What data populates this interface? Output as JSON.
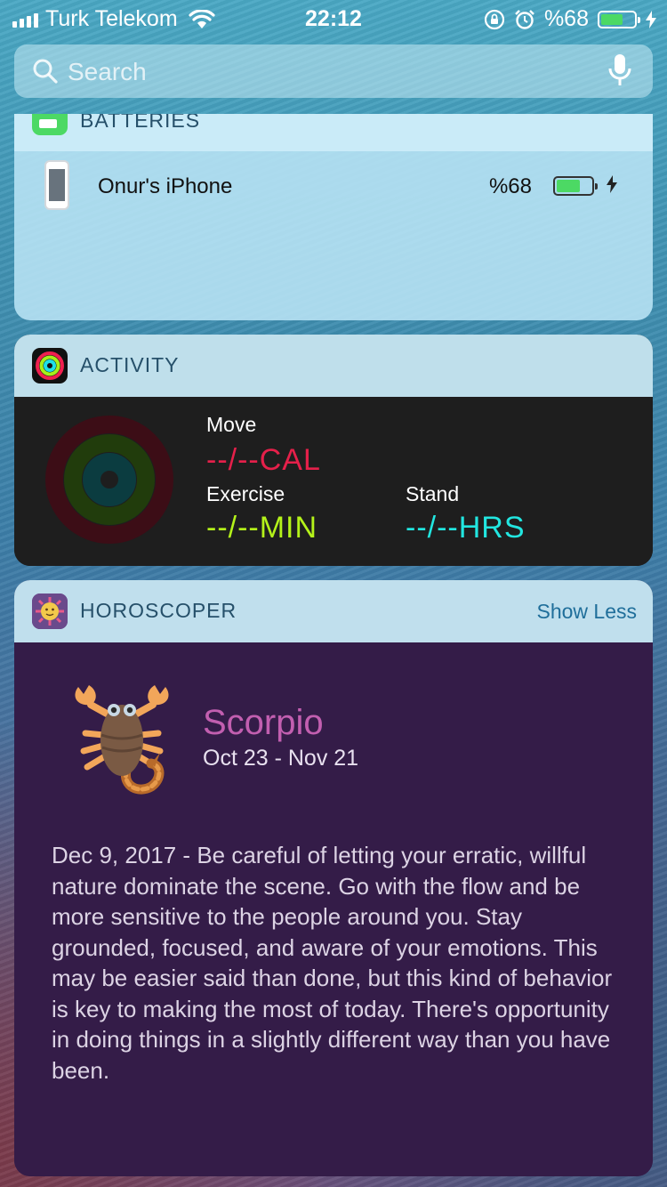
{
  "status_bar": {
    "carrier": "Turk Telekom",
    "time": "22:12",
    "battery_text": "%68",
    "battery_level": 0.68
  },
  "search": {
    "placeholder": "Search"
  },
  "batteries_widget": {
    "title": "BATTERIES",
    "devices": [
      {
        "name": "Onur's iPhone",
        "percent_text": "%68",
        "level": 0.68,
        "charging": true
      }
    ]
  },
  "activity_widget": {
    "title": "ACTIVITY",
    "move": {
      "label": "Move",
      "value": "--/--CAL",
      "color": "#e5204a"
    },
    "exercise": {
      "label": "Exercise",
      "value": "--/--MIN",
      "color": "#b4f21a"
    },
    "stand": {
      "label": "Stand",
      "value": "--/--HRS",
      "color": "#22e6e0"
    }
  },
  "horoscoper_widget": {
    "title": "HOROSCOPER",
    "action": "Show Less",
    "sign": "Scorpio",
    "date_range": "Oct 23 - Nov 21",
    "reading": "Dec 9, 2017 - Be careful of letting your erratic, willful nature dominate the scene. Go with the flow and be more sensitive to the people around you. Stay grounded, focused, and aware of your emotions. This may be easier said than done, but this kind of behavior is key to making the most of today. There's opportunity in doing things in a slightly different way than you have been."
  },
  "icons": [
    "signal-bars-icon",
    "wifi-icon",
    "rotation-lock-icon",
    "alarm-icon",
    "battery-icon",
    "charging-bolt-icon",
    "search-icon",
    "microphone-icon",
    "batteries-app-icon",
    "iphone-icon",
    "activity-app-icon",
    "horoscoper-app-icon",
    "scorpion-icon"
  ]
}
